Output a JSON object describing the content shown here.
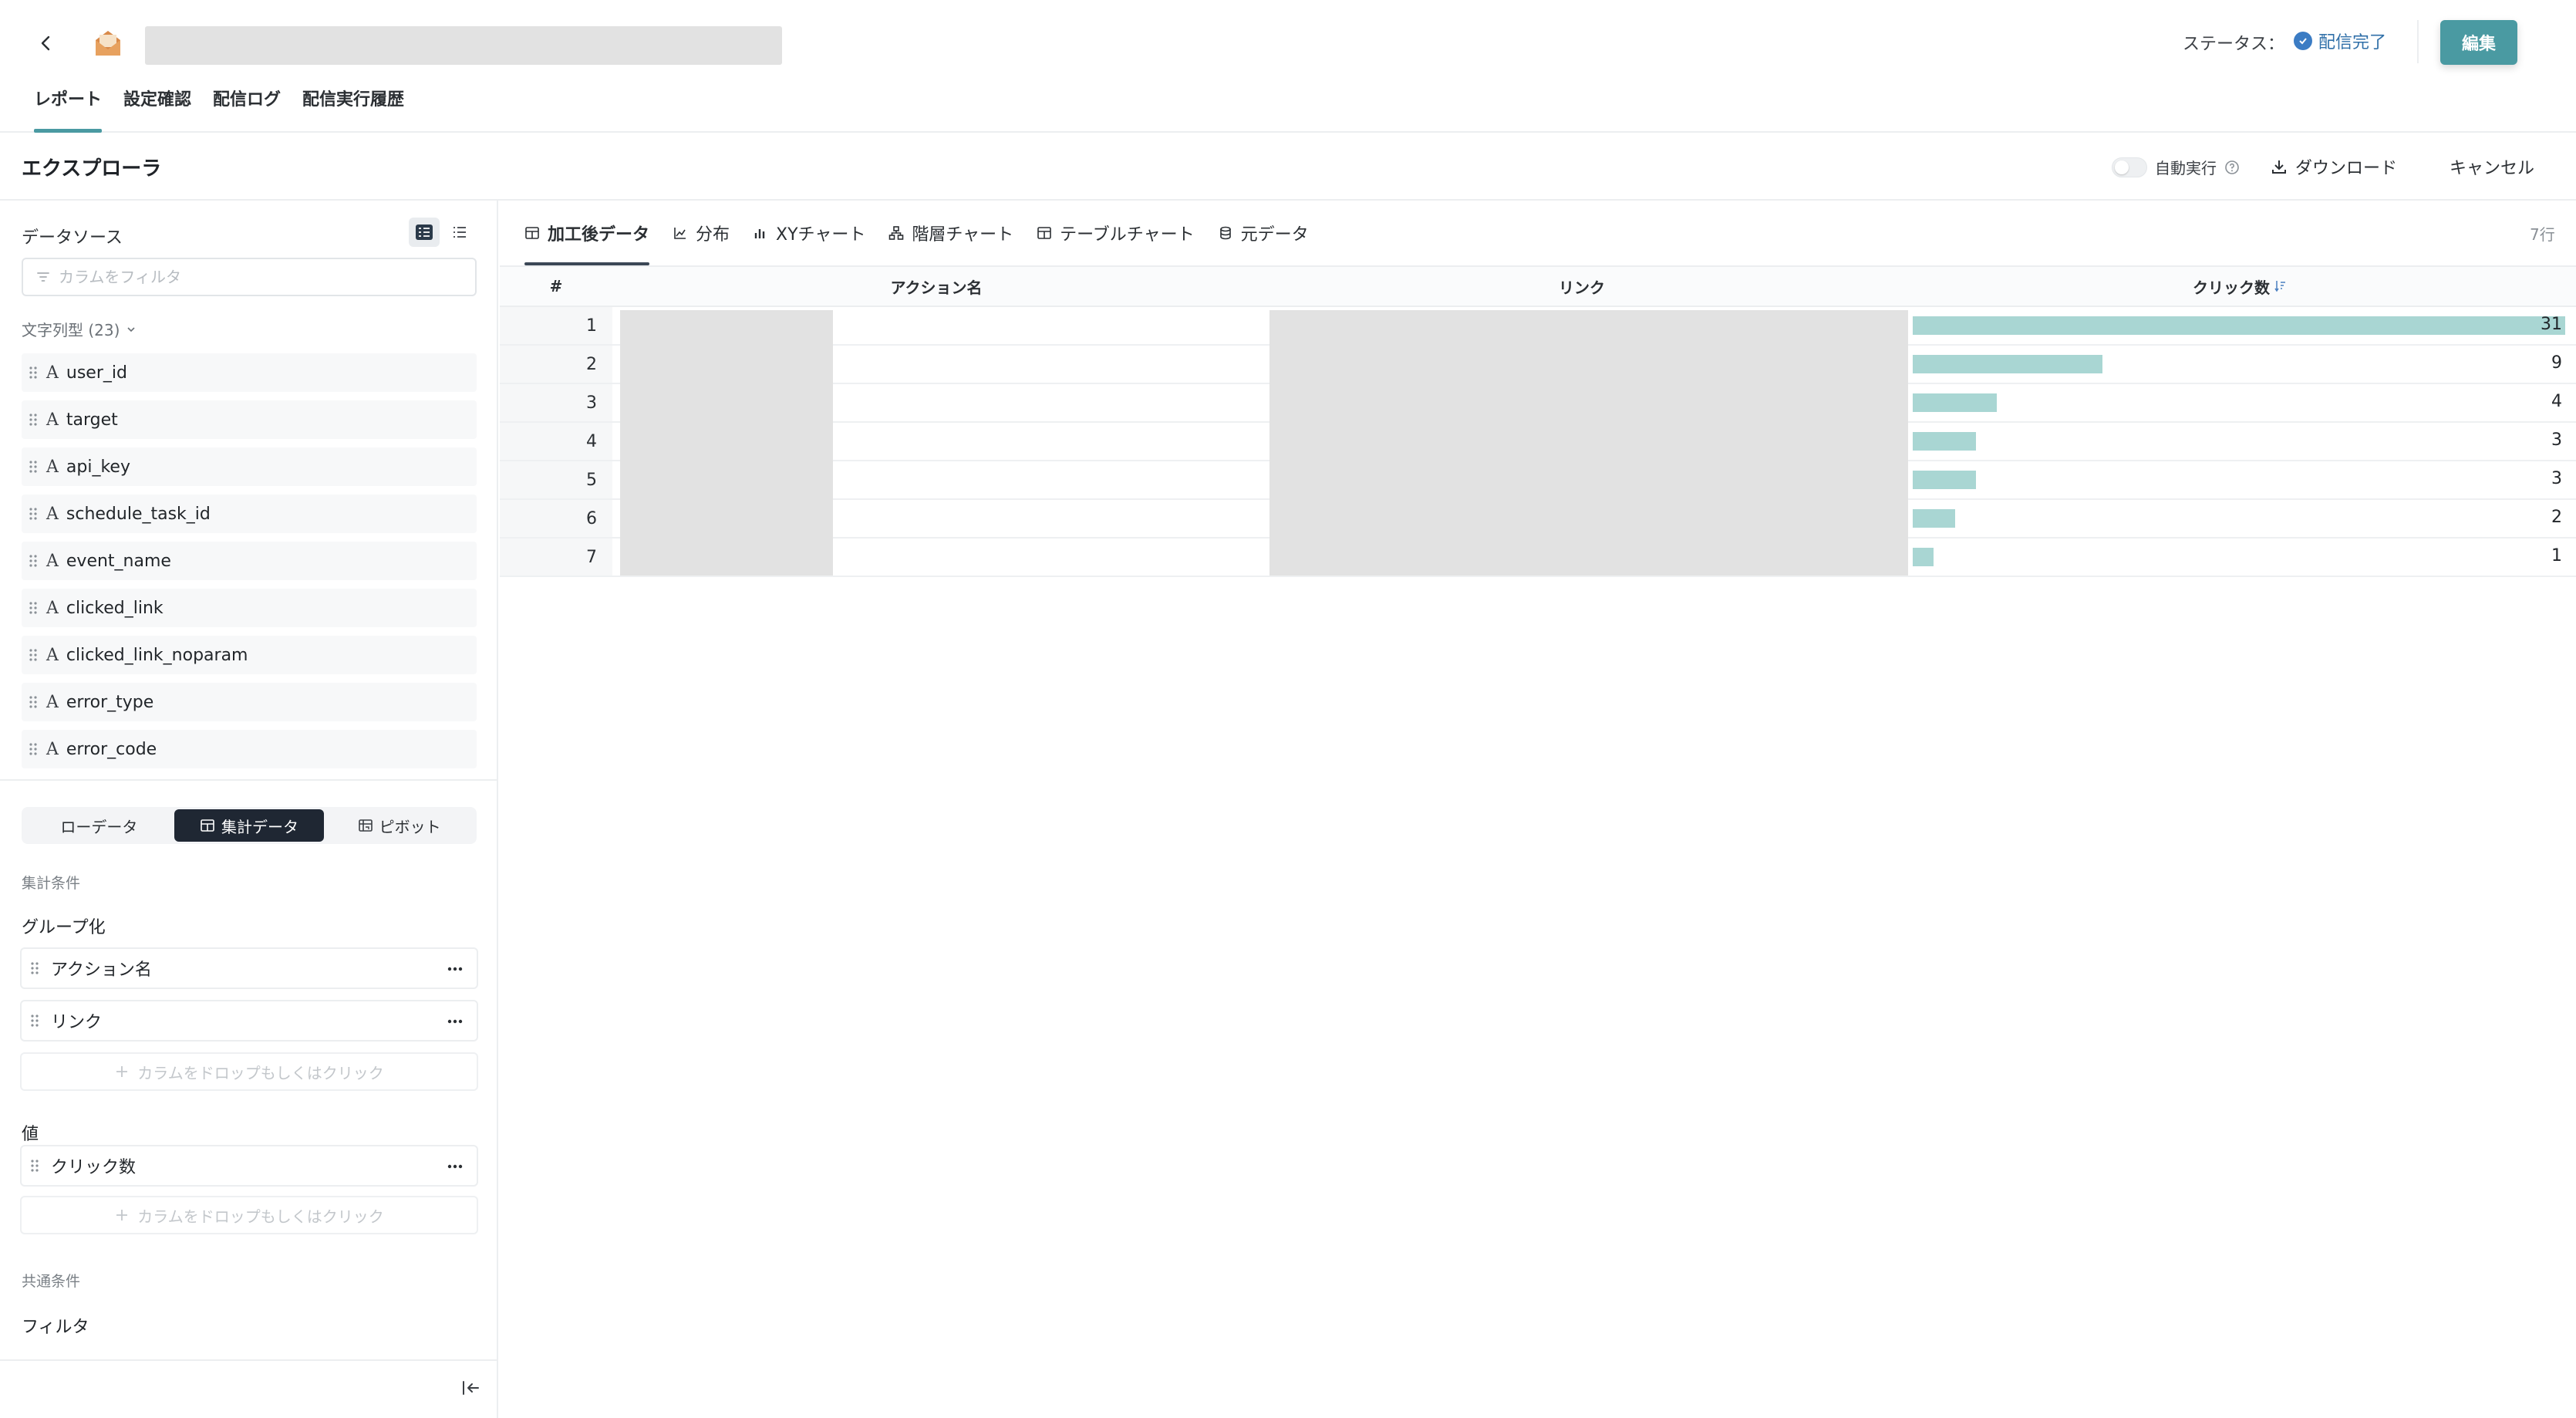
{
  "header": {
    "status_label": "ステータス：",
    "status_value": "配信完了",
    "edit_label": "編集",
    "tabs": [
      {
        "label": "レポート",
        "active": true
      },
      {
        "label": "設定確認",
        "active": false
      },
      {
        "label": "配信ログ",
        "active": false
      },
      {
        "label": "配信実行履歴",
        "active": false
      }
    ]
  },
  "explorer": {
    "title": "エクスプローラ",
    "autorun_label": "自動実行",
    "autorun_on": false,
    "download_label": "ダウンロード",
    "cancel_label": "キャンセル"
  },
  "datasource": {
    "title": "データソース",
    "filter_placeholder": "カラムをフィルタ",
    "type_group_label": "文字列型 (23)",
    "columns": [
      "user_id",
      "target",
      "api_key",
      "schedule_task_id",
      "event_name",
      "clicked_link",
      "clicked_link_noparam",
      "error_type",
      "error_code"
    ],
    "type_glyph": "A"
  },
  "mode": {
    "options": [
      {
        "label": "ローデータ",
        "active": false
      },
      {
        "label": "集計データ",
        "active": true
      },
      {
        "label": "ピボット",
        "active": false
      }
    ]
  },
  "conditions": {
    "section_label": "集計条件",
    "group_label": "グループ化",
    "groups": [
      "アクション名",
      "リンク"
    ],
    "drop_label": "カラムをドロップもしくはクリック",
    "value_label": "値",
    "values": [
      "クリック数"
    ],
    "common_label": "共通条件",
    "filter_label": "フィルタ"
  },
  "view_tabs": [
    {
      "label": "加工後データ",
      "icon": "table-icon",
      "active": true
    },
    {
      "label": "分布",
      "icon": "distribution-icon",
      "active": false
    },
    {
      "label": "XYチャート",
      "icon": "bar-chart-icon",
      "active": false
    },
    {
      "label": "階層チャート",
      "icon": "hierarchy-icon",
      "active": false
    },
    {
      "label": "テーブルチャート",
      "icon": "table-icon",
      "active": false
    },
    {
      "label": "元データ",
      "icon": "database-icon",
      "active": false
    }
  ],
  "row_count": "7行",
  "table": {
    "headers": {
      "index": "#",
      "action": "アクション名",
      "link": "リンク",
      "clicks": "クリック数"
    },
    "rows": [
      {
        "index": "1",
        "clicks": 31
      },
      {
        "index": "2",
        "clicks": 9
      },
      {
        "index": "3",
        "clicks": 4
      },
      {
        "index": "4",
        "clicks": 3
      },
      {
        "index": "5",
        "clicks": 3
      },
      {
        "index": "6",
        "clicks": 2
      },
      {
        "index": "7",
        "clicks": 1
      }
    ],
    "max_clicks": 31
  },
  "colors": {
    "accent": "#4a9aa2",
    "bar": "#a9d6d3",
    "status": "#3b7cc4",
    "segment_active": "#1f2733"
  }
}
